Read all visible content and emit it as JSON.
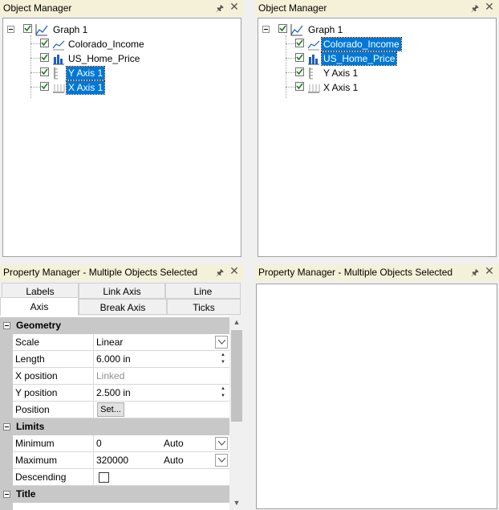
{
  "left_object_manager": {
    "title": "Object Manager",
    "items": [
      {
        "label": "Graph 1",
        "icon": "graph-icon",
        "checked": true,
        "selected": false
      },
      {
        "label": "Colorado_Income",
        "icon": "line-plot-icon",
        "checked": true,
        "selected": false
      },
      {
        "label": "US_Home_Price",
        "icon": "bar-plot-icon",
        "checked": true,
        "selected": false
      },
      {
        "label": "Y Axis 1",
        "icon": "y-axis-icon",
        "checked": true,
        "selected": true
      },
      {
        "label": "X Axis 1",
        "icon": "x-axis-icon",
        "checked": true,
        "selected": true
      }
    ]
  },
  "right_object_manager": {
    "title": "Object Manager",
    "items": [
      {
        "label": "Graph 1",
        "icon": "graph-icon",
        "checked": true,
        "selected": false
      },
      {
        "label": "Colorado_Income",
        "icon": "line-plot-icon",
        "checked": true,
        "selected": true
      },
      {
        "label": "US_Home_Price",
        "icon": "bar-plot-icon",
        "checked": true,
        "selected": true
      },
      {
        "label": "Y Axis 1",
        "icon": "y-axis-icon",
        "checked": true,
        "selected": false
      },
      {
        "label": "X Axis 1",
        "icon": "x-axis-icon",
        "checked": true,
        "selected": false
      }
    ]
  },
  "left_property_manager": {
    "title": "Property Manager - Multiple Objects Selected",
    "tabs_row1": [
      "Labels",
      "Link Axis",
      "Line"
    ],
    "tabs_row2": [
      "Axis",
      "Break Axis",
      "Ticks"
    ],
    "active_tab": "Axis",
    "categories": {
      "geometry": "Geometry",
      "limits": "Limits",
      "title": "Title"
    },
    "geometry": {
      "scale": {
        "name": "Scale",
        "value": "Linear"
      },
      "length": {
        "name": "Length",
        "value": "6.000 in"
      },
      "x_position": {
        "name": "X position",
        "value": "Linked"
      },
      "y_position": {
        "name": "Y position",
        "value": "2.500 in"
      },
      "position": {
        "name": "Position",
        "button": "Set..."
      }
    },
    "limits": {
      "minimum": {
        "name": "Minimum",
        "value": "0",
        "mode": "Auto"
      },
      "maximum": {
        "name": "Maximum",
        "value": "320000",
        "mode": "Auto"
      },
      "descending": {
        "name": "Descending",
        "checked": false
      }
    }
  },
  "right_property_manager": {
    "title": "Property Manager - Multiple Objects Selected"
  },
  "colors": {
    "titlebar_bg": "#f5f0d8",
    "selection": "#0078d7",
    "category_bg": "#c8c8c8"
  }
}
